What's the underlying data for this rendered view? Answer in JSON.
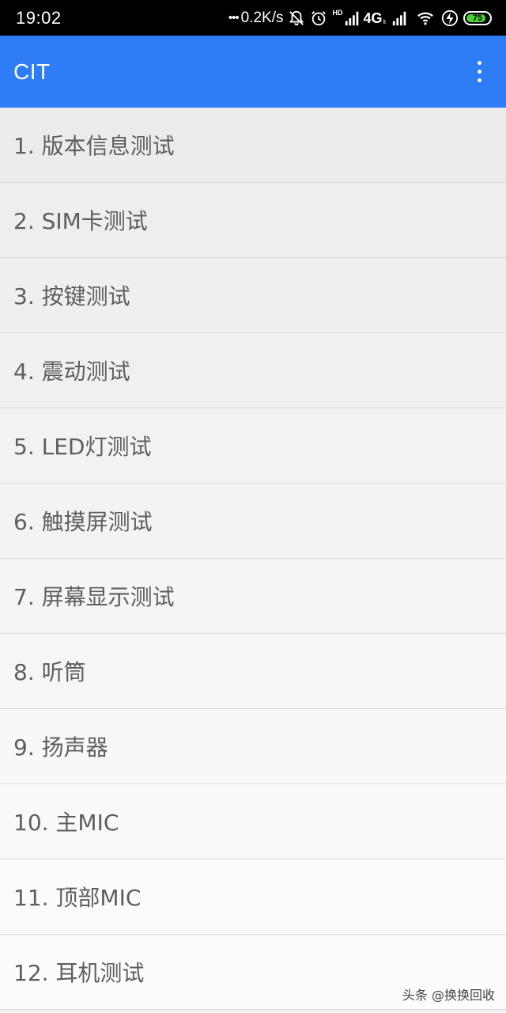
{
  "status_bar": {
    "time": "19:02",
    "network_speed": "0.2K/s",
    "hd_label": "HD",
    "network_type": "4G",
    "network_sub": "lt",
    "battery_level": "75",
    "icons": [
      "mute-bell-icon",
      "alarm-icon",
      "signal-icon",
      "signal-icon-2",
      "wifi-icon",
      "charging-icon",
      "battery-icon"
    ]
  },
  "app_bar": {
    "title": "CIT",
    "menu_icon": "more-vert-icon",
    "color": "#2e7cf6"
  },
  "list": {
    "items": [
      {
        "label": "1. 版本信息测试",
        "bg": "#ececec"
      },
      {
        "label": "2. SIM卡测试",
        "bg": "#eeeeee"
      },
      {
        "label": "3. 按键测试",
        "bg": "#efefef"
      },
      {
        "label": "4. 震动测试",
        "bg": "#f0f0f0"
      },
      {
        "label": "5. LED灯测试",
        "bg": "#f2f2f2"
      },
      {
        "label": "6. 触摸屏测试",
        "bg": "#f3f3f3"
      },
      {
        "label": "7. 屏幕显示测试",
        "bg": "#f5f5f5"
      },
      {
        "label": "8. 听筒",
        "bg": "#f6f6f6"
      },
      {
        "label": "9. 扬声器",
        "bg": "#f8f8f8"
      },
      {
        "label": "10. 主MIC",
        "bg": "#f9f9f9"
      },
      {
        "label": "11. 顶部MIC",
        "bg": "#fbfbfb"
      },
      {
        "label": "12. 耳机测试",
        "bg": "#fcfcfc"
      }
    ]
  },
  "watermark": "头条 @换换回收"
}
